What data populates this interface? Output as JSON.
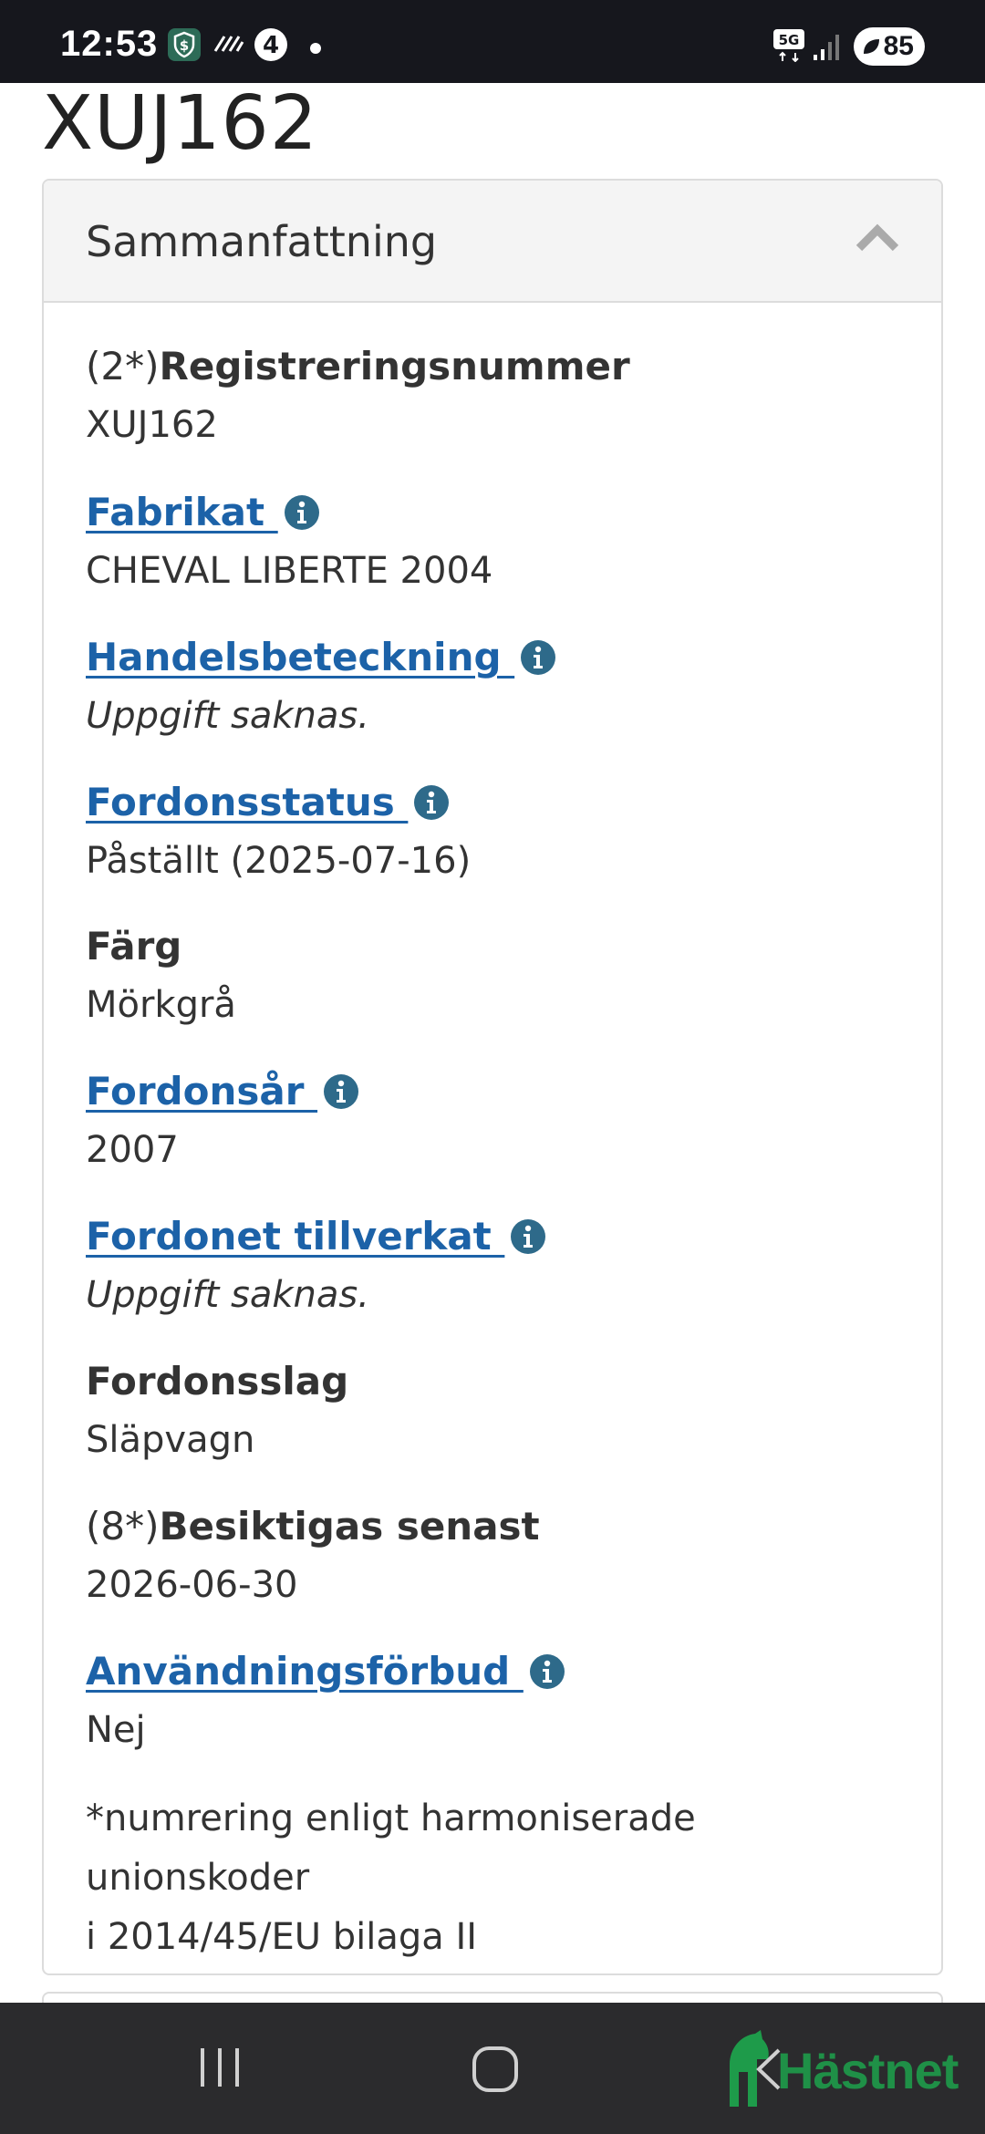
{
  "status_bar": {
    "time": "12:53",
    "network": "5G",
    "battery": "85",
    "icons": [
      "shield-dollar-icon",
      "stripes-icon",
      "four-circle-icon",
      "dot-icon",
      "5g-icon",
      "signal-icon",
      "battery-icon"
    ]
  },
  "page": {
    "title": "XUJ162"
  },
  "panel": {
    "title": "Sammanfattning",
    "toggle_icon": "chevron-up-icon"
  },
  "fields": {
    "reg": {
      "prefix": "(2*)",
      "label": "Registreringsnummer",
      "value": "XUJ162"
    },
    "fabrikat": {
      "label": "Fabrikat ",
      "value": "CHEVAL LIBERTE 2004"
    },
    "handel": {
      "label": "Handelsbeteckning ",
      "value": "Uppgift saknas."
    },
    "status": {
      "label": "Fordonsstatus ",
      "value": "Påställt (2025-07-16)"
    },
    "farg": {
      "label": "Färg",
      "value": "Mörkgrå"
    },
    "ar": {
      "label": "Fordonsår ",
      "value": "2007"
    },
    "tillverkat": {
      "label": "Fordonet tillverkat ",
      "value": "Uppgift saknas."
    },
    "slag": {
      "label": "Fordonsslag",
      "value": "Släpvagn"
    },
    "besikt": {
      "prefix": "(8*)",
      "label": "Besiktigas senast",
      "value": "2026-06-30"
    },
    "forbud": {
      "label": "Användningsförbud ",
      "value": "Nej"
    }
  },
  "footnote": {
    "line1": "*numrering enligt harmoniserade unionskoder",
    "line2": "i 2014/45/EU bilaga II"
  },
  "overlay": {
    "brand": "Hästnet"
  },
  "colors": {
    "link": "#1c62a8",
    "info_icon": "#2e6a8a",
    "status_bar": "#16171d",
    "nav_bar": "#2b2b2d",
    "brand": "#1e9b4a"
  }
}
